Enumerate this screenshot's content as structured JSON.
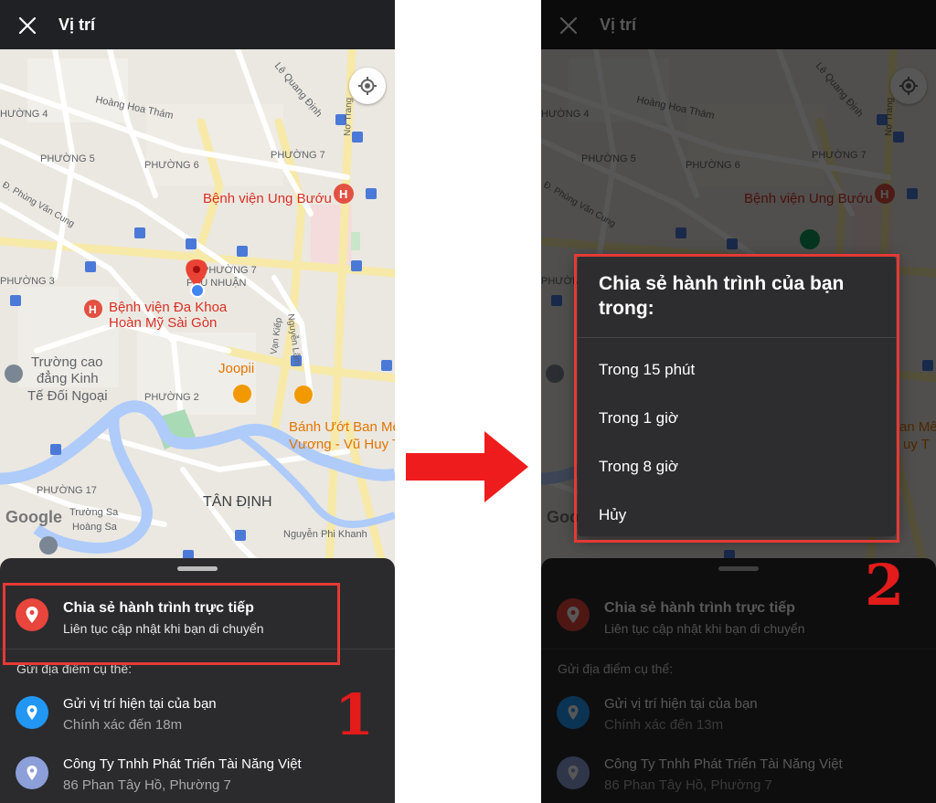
{
  "header": {
    "title": "Vị trí",
    "close_icon": "close-icon"
  },
  "map": {
    "labels": {
      "phuong4": "HƯỜNG 4",
      "phuong5": "PHƯỜNG 5",
      "phuong6": "PHƯỜNG 6",
      "phuong7a": "PHƯỜNG 7",
      "phuong7b": "PHƯỜNG 7",
      "phuong3": "PHƯỜNG 3",
      "phuong2": "PHƯỜNG 2",
      "phuong17": "PHƯỜNG 17",
      "phunhuan": "PHÚ NHUẬN",
      "tandinh": "TÂN ĐỊNH",
      "hoanghoatham": "Hoàng Hoa Thám",
      "lequangdinh": "Lê Quang Định",
      "notrang": "Nơ Trang",
      "phungvancung": "Đ. Phùng Văn Cung",
      "nguyenlam": "Nguyễn Lâm",
      "vankiep": "Vạn Kiếp",
      "truongsa": "Trường Sa",
      "hoangsa": "Hoàng Sa",
      "nguyenphikhanh": "Nguyễn Phi Khanh",
      "benhvienungbuou": "Bệnh viện Ung Bướu",
      "benhvienhoanmy_1": "Bệnh viện Đa Khoa",
      "benhvienhoanmy_2": "Hoàn Mỹ Sài Gòn",
      "truongcaodang_1": "Trường cao",
      "truongcaodang_2": "đẳng Kinh",
      "truongcaodang_3": "Tế Đối Ngoại",
      "joopii": "Joopii",
      "banhuot_1": "Bánh Ướt Ban Mê",
      "banhuot_2": "Vương - Vũ Huy T",
      "banhuot_2_right": "Vương - Vũ Huy T",
      "google": "Google"
    },
    "icons": {
      "locate": "my-location-icon",
      "pin": "location-pin-icon",
      "hospital": "hospital-icon",
      "bus": "bus-stop-icon",
      "restaurant": "restaurant-icon",
      "school": "school-icon"
    }
  },
  "sheet": {
    "live_share": {
      "title": "Chia sẻ hành trình trực tiếp",
      "subtitle": "Liên tục cập nhật khi bạn di chuyển"
    },
    "section_label": "Gửi địa điểm cụ thể:",
    "current_location_left": {
      "title": "Gửi vị trí hiện tại của bạn",
      "subtitle": "Chính xác đến 18m"
    },
    "current_location_right": {
      "title": "Gửi vị trí hiện tại của bạn",
      "subtitle": "Chính xác đến 13m"
    },
    "place": {
      "title": "Công Ty Tnhh Phát Triển Tài Năng Việt",
      "subtitle": "86 Phan Tây Hồ, Phường 7"
    }
  },
  "dialog": {
    "title": "Chia sẻ hành trình của bạn trong:",
    "options": [
      "Trong 15 phút",
      "Trong 1 giờ",
      "Trong 8 giờ",
      "Hủy"
    ]
  },
  "annotations": {
    "step1": "1",
    "step2": "2"
  },
  "colors": {
    "highlight": "#e53935",
    "arrow": "#ee1c1c",
    "live_share_icon": "#e8453c",
    "current_location_icon": "#2196f3",
    "place_icon": "#8d9fd8"
  }
}
